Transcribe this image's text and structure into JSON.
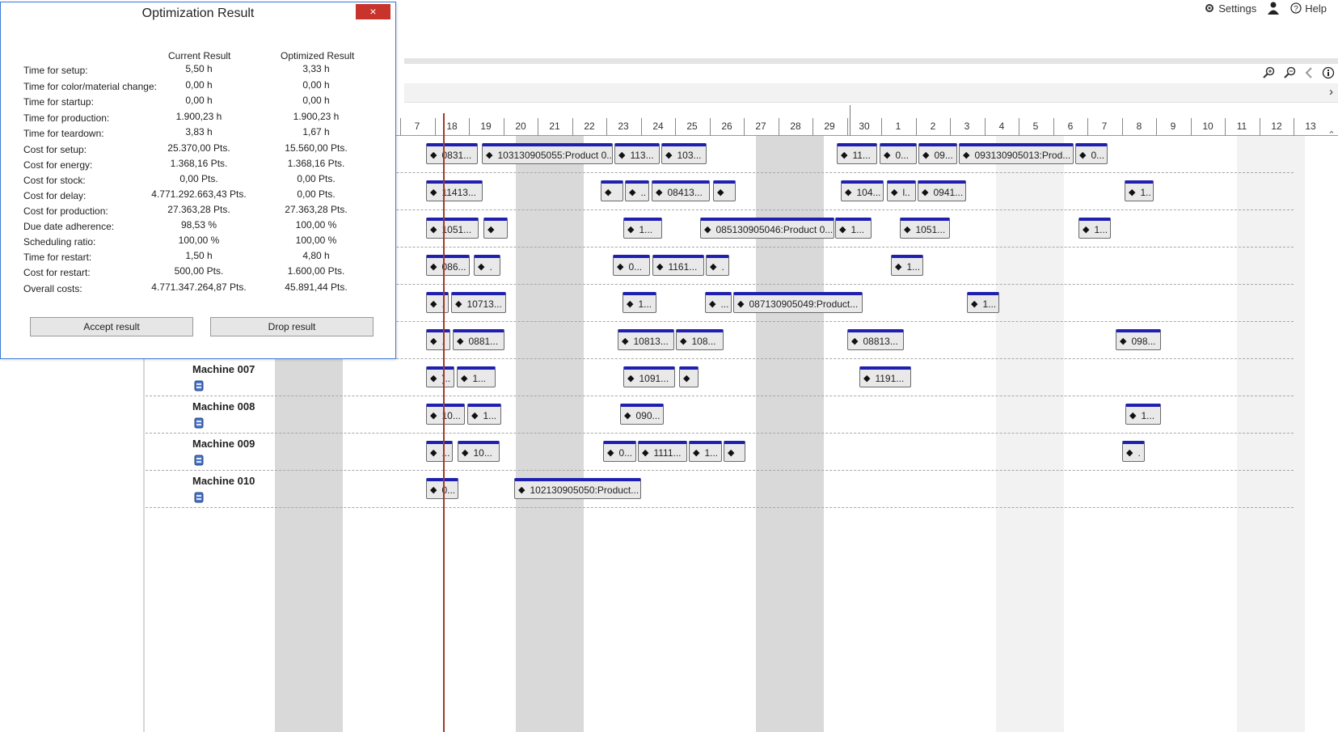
{
  "toplinks": {
    "settings": "Settings",
    "help": "Help"
  },
  "dialog": {
    "title": "Optimization Result",
    "close_label": "×",
    "col_current": "Current Result",
    "col_optimized": "Optimized Result",
    "rows": [
      {
        "label": "Time for setup:",
        "current": "5,50 h",
        "optimized": "3,33 h"
      },
      {
        "label": "Time for color/material change:",
        "current": "0,00 h",
        "optimized": "0,00 h"
      },
      {
        "label": "Time for startup:",
        "current": "0,00 h",
        "optimized": "0,00 h"
      },
      {
        "label": "Time for production:",
        "current": "1.900,23 h",
        "optimized": "1.900,23 h"
      },
      {
        "label": "Time for teardown:",
        "current": "3,83 h",
        "optimized": "1,67 h"
      },
      {
        "label": "Cost for setup:",
        "current": "25.370,00 Pts.",
        "optimized": "15.560,00 Pts."
      },
      {
        "label": "Cost for energy:",
        "current": "1.368,16 Pts.",
        "optimized": "1.368,16 Pts."
      },
      {
        "label": "Cost for stock:",
        "current": "0,00 Pts.",
        "optimized": "0,00 Pts."
      },
      {
        "label": "Cost for delay:",
        "current": "4.771.292.663,43 Pts.",
        "optimized": "0,00 Pts."
      },
      {
        "label": "Cost for production:",
        "current": "27.363,28 Pts.",
        "optimized": "27.363,28 Pts."
      },
      {
        "label": "Due date adherence:",
        "current": "98,53 %",
        "optimized": "100,00 %"
      },
      {
        "label": "Scheduling ratio:",
        "current": "100,00 %",
        "optimized": "100,00 %"
      },
      {
        "label": "Time for restart:",
        "current": "1,50 h",
        "optimized": "4,80 h"
      },
      {
        "label": "Cost for restart:",
        "current": "500,00 Pts.",
        "optimized": "1.600,00 Pts."
      },
      {
        "label": "Overall costs:",
        "current": "4.771.347.264,87 Pts.",
        "optimized": "45.891,44 Pts."
      }
    ],
    "accept_label": "Accept result",
    "drop_label": "Drop result"
  },
  "days": [
    "7",
    "18",
    "19",
    "20",
    "21",
    "22",
    "23",
    "24",
    "25",
    "26",
    "27",
    "28",
    "29",
    "30",
    "1",
    "2",
    "3",
    "4",
    "5",
    "6",
    "7",
    "8",
    "9",
    "10",
    "11",
    "12",
    "13"
  ],
  "machines": [
    {
      "name": "",
      "bars": [
        "0831...",
        "103130905055:Product 0...",
        "113...",
        "103...",
        "11...",
        "0...",
        "09...",
        "093130905013:Prod...",
        "0..."
      ]
    },
    {
      "name": "",
      "bars": [
        "11413...",
        "",
        "..",
        "08413...",
        "",
        "104...",
        "l..",
        "0941...",
        "1.."
      ]
    },
    {
      "name": "",
      "bars": [
        "1051...",
        "",
        "1...",
        "085130905046:Product 0...",
        "1...",
        "1051...",
        "1..."
      ]
    },
    {
      "name": "",
      "bars": [
        "086...",
        ".",
        "0...",
        "1161...",
        ".",
        "1..."
      ]
    },
    {
      "name": "",
      "bars": [
        ".",
        "10713...",
        "1...",
        "...",
        "087130905049:Product...",
        "1..."
      ]
    },
    {
      "name": "",
      "bars": [
        ".",
        "0881...",
        "10813...",
        "108...",
        "08813...",
        "098..."
      ]
    },
    {
      "name": "Machine 007",
      "bars": [
        ")..",
        "1...",
        "1091...",
        "",
        "1191..."
      ]
    },
    {
      "name": "Machine 008",
      "bars": [
        "10...",
        "1...",
        "090...",
        "1..."
      ]
    },
    {
      "name": "Machine 009",
      "bars": [
        "...",
        "10...",
        "0...",
        "1111...",
        "1...",
        "",
        "."
      ]
    },
    {
      "name": "Machine 010",
      "bars": [
        "0...",
        "102130905050:Product..."
      ]
    }
  ]
}
